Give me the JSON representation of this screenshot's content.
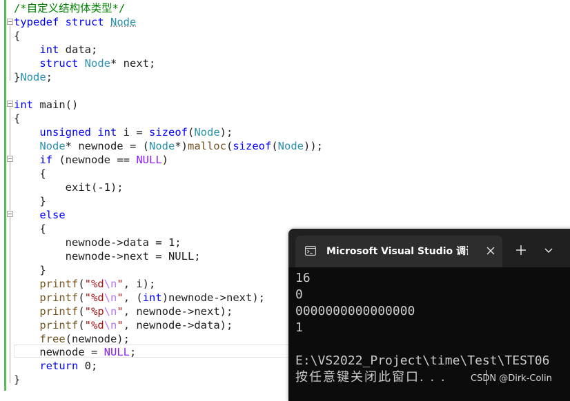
{
  "editor": {
    "comment": "/*自定义结构体类型*/",
    "kw_typedef": "typedef",
    "kw_struct": "struct",
    "type_node": "Node",
    "brace_open": "{",
    "brace_close": "}",
    "kw_int": "int",
    "field_data": " data;",
    "struct_next_prefix": "    ",
    "ptr_next": "* next;",
    "closing_node": "Node",
    "semicolon": ";",
    "main_sig": " main()",
    "kw_unsigned": "unsigned",
    "i_decl": " i = ",
    "kw_sizeof": "sizeof",
    "lparen": "(",
    "rparen_semi": ");",
    "newnode_decl": "* newnode = (",
    "ptr_cast": "*)",
    "fn_malloc": "malloc",
    "rparen2_semi": "));",
    "kw_if": "if",
    "if_cond": " (newnode == ",
    "null": "NULL",
    "rparen": ")",
    "exit_call": "exit(-1);",
    "kw_else": "else",
    "assign_data": "newnode->data = 1;",
    "assign_next": "newnode->next = NULL;",
    "fn_printf": "printf",
    "str_d": "\"%d",
    "str_p": "\"%p",
    "esc_n": "\\n",
    "quote": "\"",
    "arg_i": ", i);",
    "arg_cast_open": ", (",
    "arg_int_next": ")newnode->next);",
    "arg_next": ", newnode->next);",
    "arg_data": ", newnode->data);",
    "fn_free": "free",
    "free_arg": "(newnode);",
    "newnode_assign": "newnode = ",
    "kw_return": "return",
    "return_val": " 0;"
  },
  "terminal": {
    "tab_title": "Microsoft Visual Studio 调试控",
    "tab_icon": "terminal-icon",
    "close_icon": "close-icon",
    "newtab_icon": "plus-icon",
    "dropdown_icon": "chevron-down-icon",
    "output": [
      "16",
      "0",
      "0000000000000000",
      "1"
    ],
    "path_line": "E:\\VS2022_Project\\time\\Test\\TEST06",
    "prompt_line": "按任意键关闭此窗口. . ."
  },
  "watermark": "CSDN @Dirk-Colin",
  "colors": {
    "keyword": "#0000ff",
    "type": "#2b91af",
    "comment": "#008000",
    "string": "#a31515",
    "escape": "#b776fb",
    "function": "#74531f",
    "macro": "#8a1bff",
    "terminal_bg": "#0c0c0c",
    "change_bar": "#5cb85c"
  }
}
